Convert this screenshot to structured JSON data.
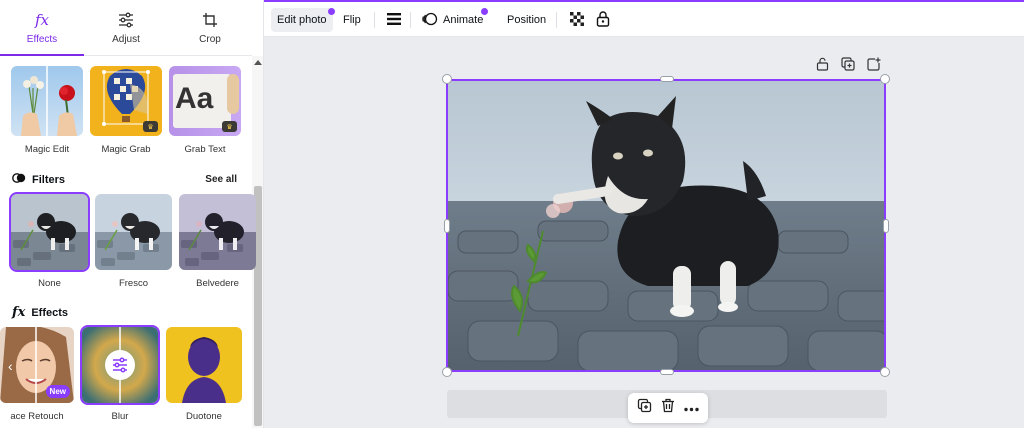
{
  "tabs": [
    {
      "label": "Effects",
      "icon": "fx-icon"
    },
    {
      "label": "Adjust",
      "icon": "sliders-icon"
    },
    {
      "label": "Crop",
      "icon": "crop-icon"
    }
  ],
  "magic": {
    "items": [
      {
        "label": "Magic Edit"
      },
      {
        "label": "Magic Grab"
      },
      {
        "label": "Grab Text",
        "thumb_text": "Aa"
      }
    ]
  },
  "filters": {
    "title": "Filters",
    "see_all": "See all",
    "items": [
      {
        "label": "None"
      },
      {
        "label": "Fresco"
      },
      {
        "label": "Belvedere"
      }
    ]
  },
  "effects": {
    "title": "Effects",
    "items": [
      {
        "label": "ace Retouch",
        "badge": "New"
      },
      {
        "label": "Blur"
      },
      {
        "label": "Duotone"
      }
    ]
  },
  "toolbar": {
    "edit_photo": "Edit photo",
    "flip": "Flip",
    "animate": "Animate",
    "position": "Position"
  },
  "colors": {
    "accent": "#8b3dff",
    "canvas_bg": "#ebecf0"
  }
}
